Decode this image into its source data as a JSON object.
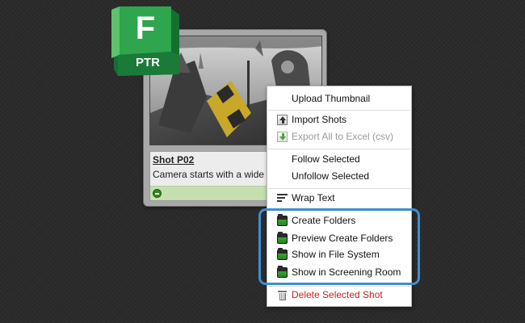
{
  "logo": {
    "letter": "F",
    "product": "PTR"
  },
  "shot_card": {
    "title": "Shot P02",
    "description": "Camera starts with a wide view",
    "status_color": "#2d8a1e"
  },
  "context_menu": {
    "upload_thumbnail": "Upload Thumbnail",
    "import_shots": "Import Shots",
    "export_excel": "Export All to Excel (csv)",
    "follow_selected": "Follow Selected",
    "unfollow_selected": "Unfollow Selected",
    "wrap_text": "Wrap Text",
    "create_folders": "Create Folders",
    "preview_create_folders": "Preview Create Folders",
    "show_in_file_system": "Show in File System",
    "show_in_screening_room": "Show in Screening Room",
    "delete_selected_shot": "Delete Selected Shot"
  },
  "colors": {
    "highlight": "#3d8ed2",
    "danger": "#cc1d1d",
    "logo_green": "#1f8a3e"
  }
}
